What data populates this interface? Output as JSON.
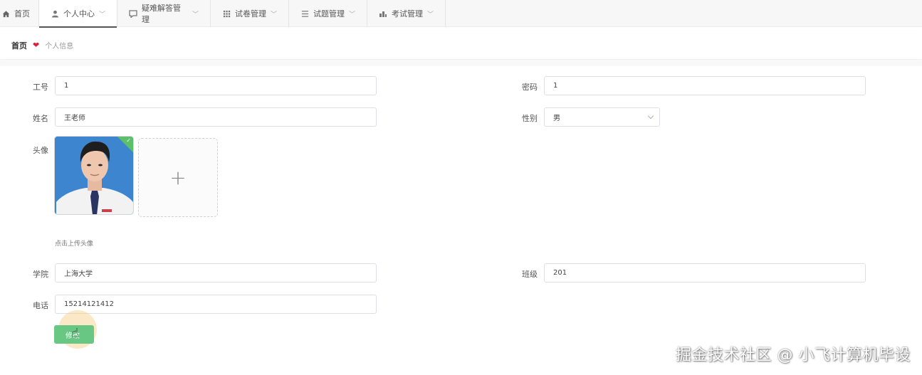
{
  "nav": {
    "items": [
      {
        "label": "首页",
        "icon": "home-icon"
      },
      {
        "label": "个人中心",
        "icon": "user-icon",
        "active": true
      },
      {
        "label": "疑难解答管理",
        "icon": "qa-icon"
      },
      {
        "label": "试卷管理",
        "icon": "grid-icon"
      },
      {
        "label": "试题管理",
        "icon": "list-icon"
      },
      {
        "label": "考试管理",
        "icon": "exam-icon"
      }
    ]
  },
  "breadcrumb": {
    "home": "首页",
    "current": "个人信息"
  },
  "form": {
    "id_label": "工号",
    "id_value": "1",
    "password_label": "密码",
    "password_value": "1",
    "name_label": "姓名",
    "name_value": "王老师",
    "gender_label": "性别",
    "gender_value": "男",
    "avatar_label": "头像",
    "avatar_hint": "点击上传头像",
    "college_label": "学院",
    "college_value": "上海大学",
    "class_label": "班级",
    "class_value": "201",
    "phone_label": "电话",
    "phone_value": "15214121412",
    "submit_label": "修改"
  },
  "watermark": "掘金技术社区 @ 小飞计算机毕设",
  "colors": {
    "accent_green": "#67c783",
    "crumb_heart": "#e0203a"
  }
}
